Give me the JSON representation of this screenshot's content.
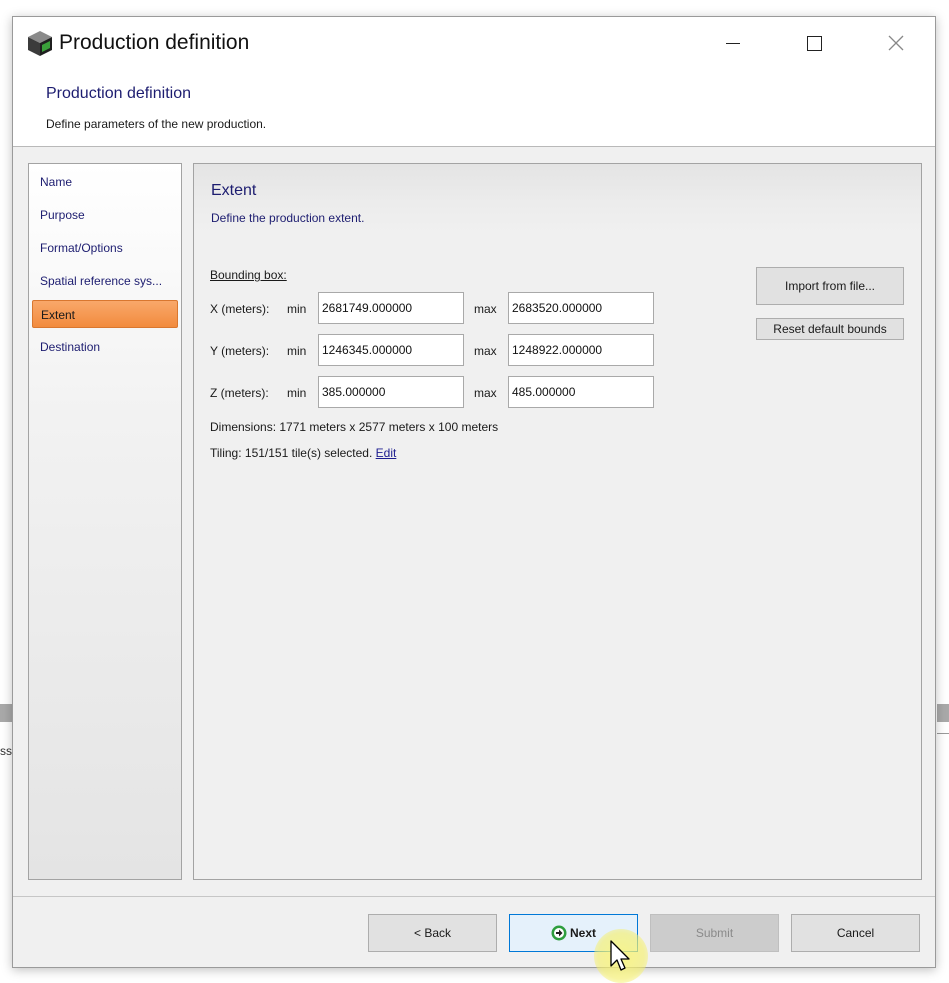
{
  "window": {
    "title": "Production definition",
    "icon": "box-app-icon",
    "controls": {
      "minimize": "minimize-icon",
      "maximize": "maximize-icon",
      "close": "close-icon"
    }
  },
  "header": {
    "title": "Production definition",
    "description": "Define parameters of the new production."
  },
  "nav": {
    "items": [
      {
        "label": "Name"
      },
      {
        "label": "Purpose"
      },
      {
        "label": "Format/Options"
      },
      {
        "label": "Spatial reference sys..."
      },
      {
        "label": "Extent",
        "active": true
      },
      {
        "label": "Destination"
      }
    ]
  },
  "panel": {
    "title": "Extent",
    "description": "Define the production extent.",
    "bbox_label": "Bounding box:",
    "min_label": "min",
    "max_label": "max",
    "rows": [
      {
        "label": "X (meters):",
        "min": "2681749.000000",
        "max": "2683520.000000"
      },
      {
        "label": "Y (meters):",
        "min": "1246345.000000",
        "max": "1248922.000000"
      },
      {
        "label": "Z (meters):",
        "min": "385.000000",
        "max": "485.000000"
      }
    ],
    "dimensions": "Dimensions: 1771 meters x 2577 meters x 100 meters",
    "tiling": "Tiling: 151/151 tile(s) selected.",
    "edit_link": "Edit",
    "import_button": "Import from file...",
    "reset_button": "Reset default bounds"
  },
  "footer": {
    "back": "< Back",
    "next": "Next",
    "submit": "Submit",
    "cancel": "Cancel"
  },
  "background": {
    "left_text": "ss"
  },
  "colors": {
    "accent_active": "#f28b3e",
    "heading": "#1d1d70",
    "focus_border": "#0078d7"
  }
}
